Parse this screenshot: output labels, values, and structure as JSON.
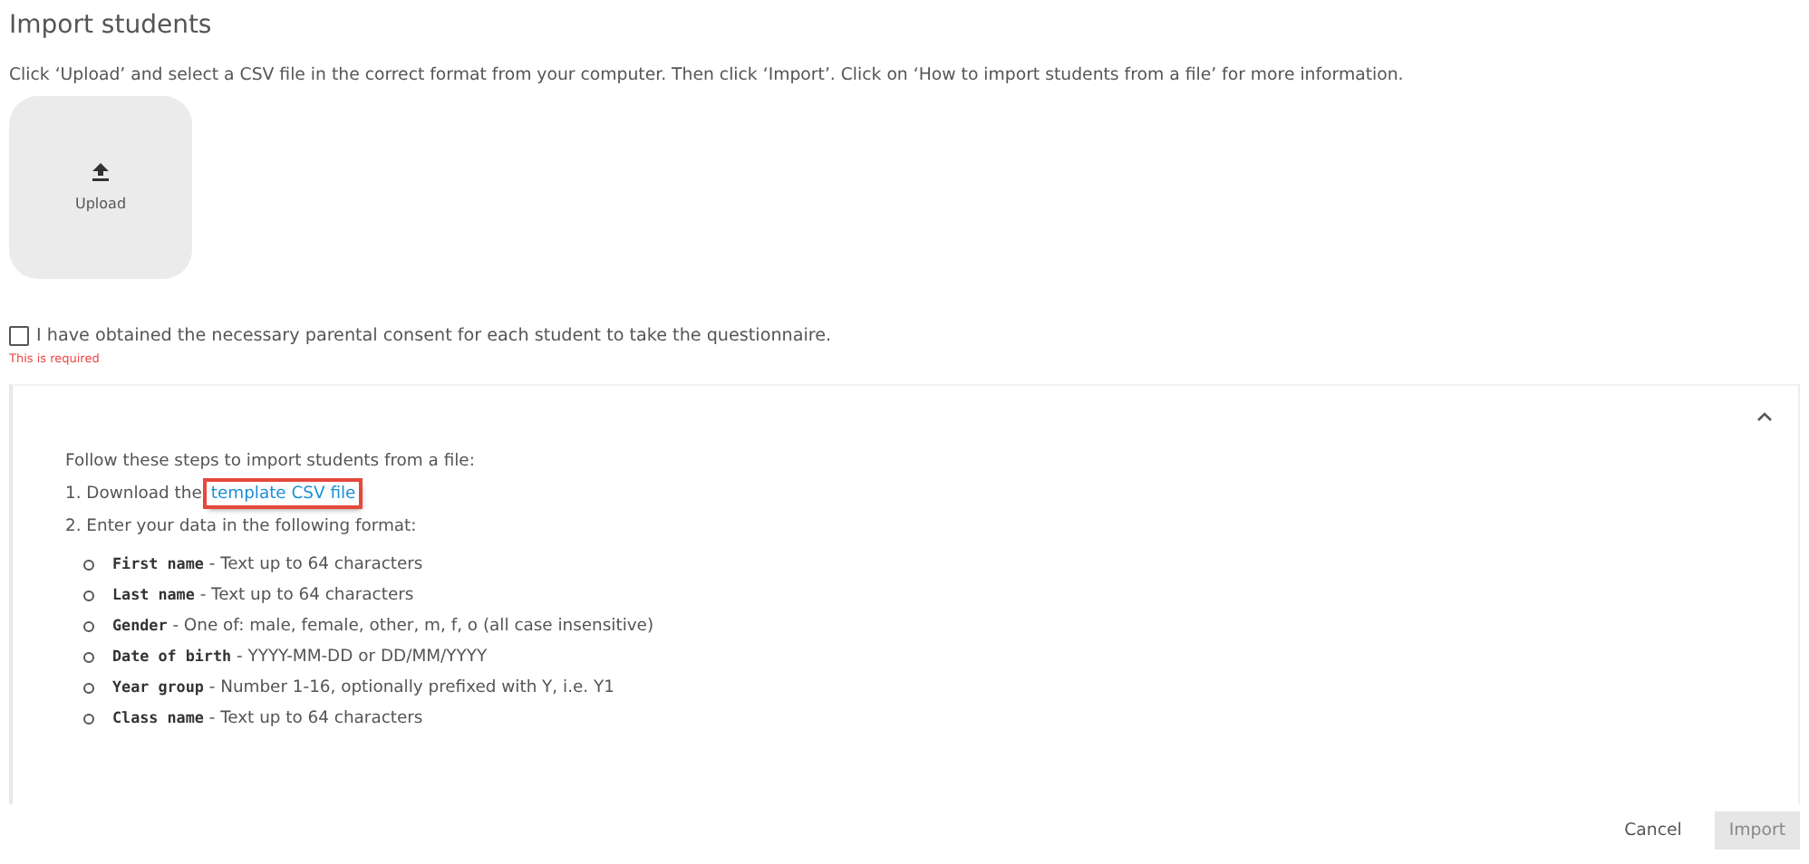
{
  "title": "Import students",
  "instructions": "Click ‘Upload’ and select a CSV file in the correct format from your computer. Then click ‘Import’. Click on ‘How to import students from a file’ for more information.",
  "upload": {
    "label": "Upload"
  },
  "consent": {
    "label": "I have obtained the necessary parental consent for each student to take the questionnaire.",
    "checked": false,
    "error": "This is required"
  },
  "help_panel": {
    "expanded": true,
    "intro": "Follow these steps to import students from a file:",
    "step_1": {
      "text": "1. Download the",
      "link": "template CSV file",
      "highlighted": true
    },
    "step_2": "2. Enter your data in the following format:",
    "fields": [
      {
        "name": "First name",
        "description": "- Text up to 64 characters"
      },
      {
        "name": "Last name",
        "description": "- Text up to 64 characters"
      },
      {
        "name": "Gender",
        "description": "- One of: male, female, other, m, f, o (all case insensitive)"
      },
      {
        "name": "Date of birth",
        "description": "- YYYY-MM-DD or DD/MM/YYYY"
      },
      {
        "name": "Year group",
        "description": "- Number 1-16, optionally prefixed with Y, i.e. Y1"
      },
      {
        "name": "Class name",
        "description": "- Text up to 64 characters"
      }
    ]
  },
  "buttons": [
    {
      "label": "Cancel",
      "disabled": false
    },
    {
      "label": "Import",
      "disabled": true
    }
  ]
}
